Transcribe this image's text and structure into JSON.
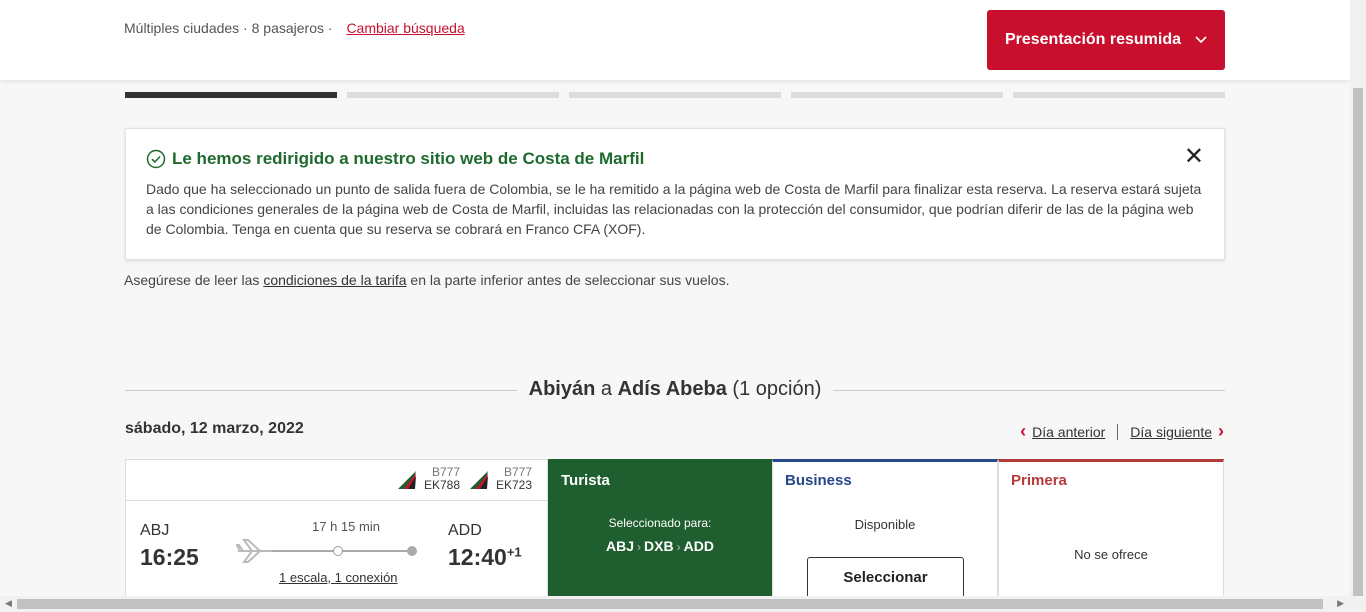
{
  "header": {
    "summary": "Múltiples ciudades · 8 pasajeros ·",
    "change_search": "Cambiar búsqueda",
    "presentation_button": "Presentación resumida"
  },
  "progress": {
    "total_steps": 5,
    "active_step": 1
  },
  "alert": {
    "title": "Le hemos redirigido a nuestro sitio web de Costa de Marfil",
    "body": "Dado que ha seleccionado un punto de salida fuera de Colombia, se le ha remitido a la página web de Costa de Marfil para finalizar esta reserva. La reserva estará sujeta a las condiciones generales de la página web de Costa de Marfil, incluidas las relacionadas con la protección del consumidor, que podrían diferir de las de la página web de Colombia. Tenga en cuenta que su reserva se cobrará en Franco CFA (XOF)."
  },
  "hint": {
    "before": "Asegúrese de leer las ",
    "link": "condiciones de la tarifa",
    "after": " en la parte inferior antes de seleccionar sus vuelos."
  },
  "route": {
    "from": "Abiyán",
    "connector": "a",
    "to": "Adís Abeba",
    "options": "(1 opción)"
  },
  "date": "sábado, 12 marzo, 2022",
  "day_nav": {
    "prev": "Día anterior",
    "next": "Día siguiente"
  },
  "flight": {
    "segments": [
      {
        "aircraft": "B777",
        "flight_no": "EK788"
      },
      {
        "aircraft": "B777",
        "flight_no": "EK723"
      }
    ],
    "origin": "ABJ",
    "departure": "16:25",
    "duration": "17 h 15 min",
    "stops": "1 escala, 1 conexión",
    "destination": "ADD",
    "arrival": "12:40",
    "day_offset": "+1"
  },
  "cabins": {
    "turista": {
      "name": "Turista",
      "selected_for": "Seleccionado para:",
      "path": [
        "ABJ",
        "DXB",
        "ADD"
      ]
    },
    "business": {
      "name": "Business",
      "status": "Disponible",
      "button": "Seleccionar"
    },
    "primera": {
      "name": "Primera",
      "status": "No se ofrece"
    }
  },
  "colors": {
    "brand_red": "#c8102e",
    "success_green": "#1e6a2e",
    "turista_bg": "#1f5e2e",
    "business_blue": "#27488b",
    "primera_red": "#b53a3a"
  },
  "icons": [
    "chevron-down-icon",
    "check-circle-icon",
    "close-icon",
    "airline-tail-icon",
    "plane-icon",
    "chevron-left-icon",
    "chevron-right-icon"
  ]
}
